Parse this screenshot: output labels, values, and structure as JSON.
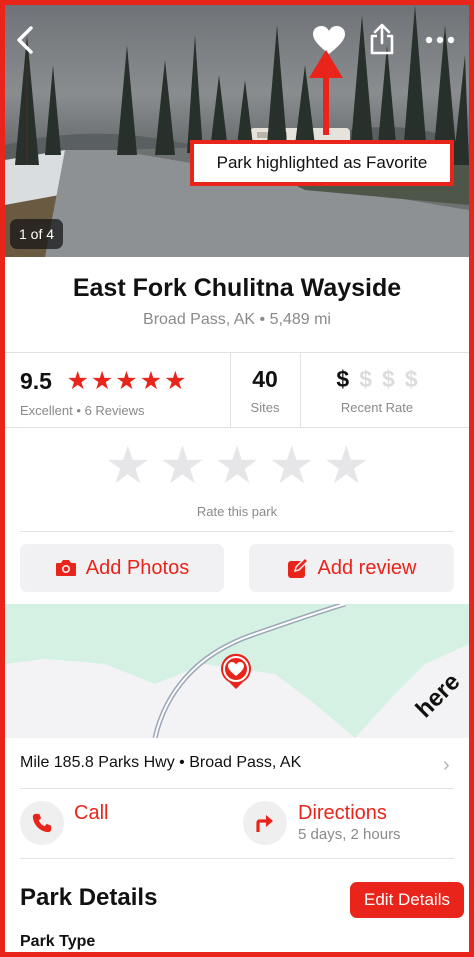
{
  "hero": {
    "photo_counter": "1 of 4",
    "annotation": "Park highlighted as Favorite"
  },
  "park": {
    "name": "East Fork Chulitna Wayside",
    "location": "Broad Pass, AK",
    "distance": "5,489 mi",
    "separator": "•"
  },
  "stats": {
    "rating": "9.5",
    "rating_stars_filled": 5,
    "rating_label": "Excellent",
    "reviews": "6 Reviews",
    "sites_count": "40",
    "sites_label": "Sites",
    "price_symbol": "$",
    "price_level": 1,
    "price_max": 4,
    "rate_label": "Recent Rate"
  },
  "rate_this": {
    "label": "Rate this park",
    "stars": 5
  },
  "actions": {
    "add_photos": "Add Photos",
    "add_review": "Add review"
  },
  "map": {
    "provider_logo": "here"
  },
  "address": {
    "line": "Mile 185.8 Parks Hwy • Broad Pass, AK"
  },
  "contact": {
    "call_label": "Call",
    "directions_label": "Directions",
    "directions_eta": "5 days, 2 hours"
  },
  "details": {
    "title": "Park Details",
    "edit_label": "Edit Details",
    "first_field": "Park Type"
  },
  "colors": {
    "accent": "#e8241b",
    "muted_text": "#8a8a8a",
    "map_green": "#d4f1e4"
  },
  "icons": {
    "back": "chevron-left-icon",
    "favorite": "heart-icon",
    "share": "share-icon",
    "more": "ellipsis-icon",
    "camera": "camera-icon",
    "edit": "pencil-square-icon",
    "pin": "heart-pin-icon",
    "phone": "phone-icon",
    "directions": "turn-right-icon"
  }
}
